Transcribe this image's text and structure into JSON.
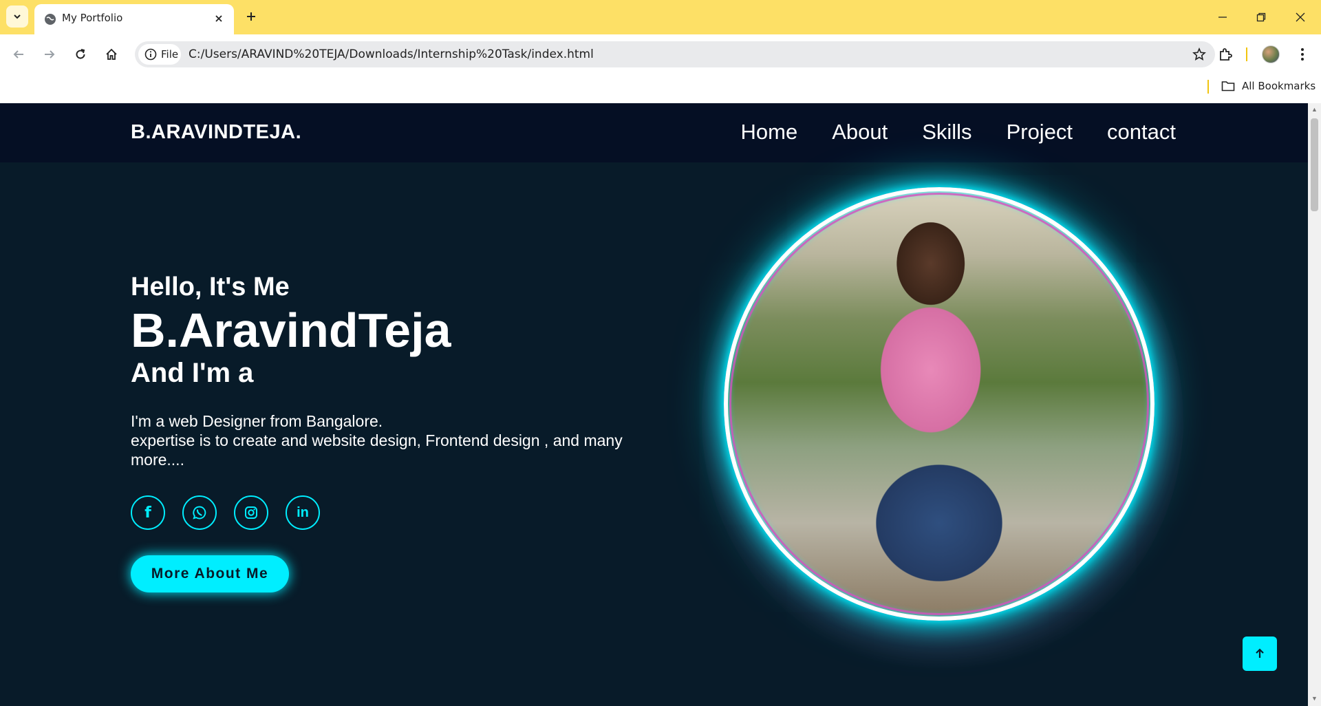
{
  "browser": {
    "tab_title": "My Portfolio",
    "address": {
      "chip_label": "File",
      "url": "C:/Users/ARAVIND%20TEJA/Downloads/Internship%20Task/index.html"
    },
    "bookmarks_label": "All Bookmarks",
    "icons": [
      "tab-search-icon",
      "globe-icon",
      "close-icon",
      "plus-icon",
      "minimize-icon",
      "restore-icon",
      "window-close-icon",
      "back-arrow-icon",
      "forward-arrow-icon",
      "reload-icon",
      "home-icon",
      "info-icon",
      "star-icon",
      "extensions-icon",
      "more-vert-icon",
      "folder-icon"
    ]
  },
  "site": {
    "brand": "B.ARAVINDTEJA.",
    "nav": [
      "Home",
      "About",
      "Skills",
      "Project",
      "contact"
    ],
    "hero": {
      "greeting": "Hello, It's Me",
      "name": "B.AravindTeja",
      "role": "And I'm a",
      "bio_line1": "I'm a web Designer from Bangalore.",
      "bio_line2": "expertise is to create and website design, Frontend design , and many more...."
    },
    "socials": [
      {
        "icon": "facebook-icon",
        "glyph": "f"
      },
      {
        "icon": "whatsapp-icon",
        "glyph": ""
      },
      {
        "icon": "instagram-icon",
        "glyph": ""
      },
      {
        "icon": "linkedin-icon",
        "glyph": "in"
      }
    ],
    "cta_label": "More About Me",
    "accent_color": "#00eeff",
    "background_color": "#081b29",
    "header_color": "#050f24"
  }
}
